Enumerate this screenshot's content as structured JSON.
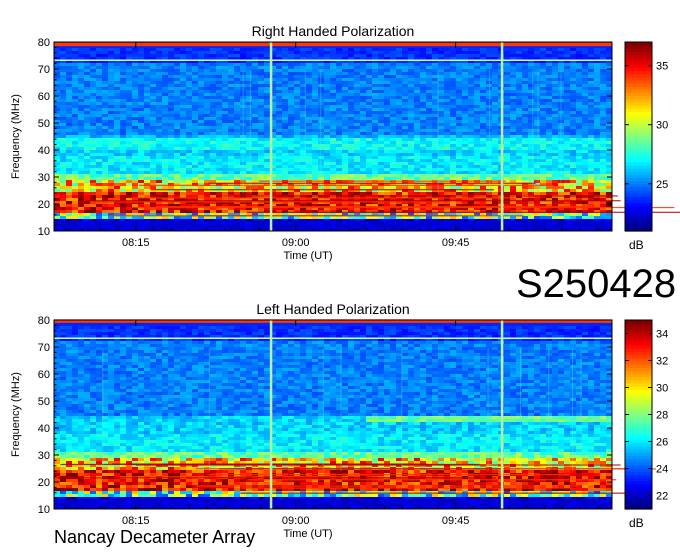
{
  "event_id": "S250428",
  "instrument": "Nancay Decameter Array",
  "chart_data": [
    {
      "type": "heatmap",
      "title": "Right Handed Polarization",
      "xlabel": "Time (UT)",
      "ylabel": "Frequency (MHz)",
      "x_ticks": [
        "08:15",
        "09:00",
        "09:45"
      ],
      "x_range_minutes": [
        472,
        629
      ],
      "y_ticks": [
        10,
        20,
        30,
        40,
        50,
        60,
        70,
        80
      ],
      "ylim": [
        10,
        80
      ],
      "colorbar": {
        "label": "dB",
        "ticks": [
          25,
          30,
          35
        ],
        "range": [
          21,
          37
        ],
        "colormap": "jet"
      },
      "features": {
        "vertical_lines_minutes": [
          533,
          598
        ],
        "horizontal_lines_mhz": [
          73.3,
          79.0
        ],
        "intense_band_mhz": [
          15,
          29
        ]
      }
    },
    {
      "type": "heatmap",
      "title": "Left Handed Polarization",
      "xlabel": "Time (UT)",
      "ylabel": "Frequency (MHz)",
      "x_ticks": [
        "08:15",
        "09:00",
        "09:45"
      ],
      "x_range_minutes": [
        472,
        629
      ],
      "y_ticks": [
        10,
        20,
        30,
        40,
        50,
        60,
        70,
        80
      ],
      "ylim": [
        10,
        80
      ],
      "colorbar": {
        "label": "dB",
        "ticks": [
          22,
          24,
          26,
          28,
          30,
          32,
          34
        ],
        "range": [
          21,
          35
        ],
        "colormap": "jet"
      },
      "features": {
        "vertical_lines_minutes": [
          533,
          598
        ],
        "horizontal_lines_mhz": [
          73.3,
          79.5
        ],
        "intense_band_mhz": [
          15,
          29
        ]
      }
    }
  ]
}
